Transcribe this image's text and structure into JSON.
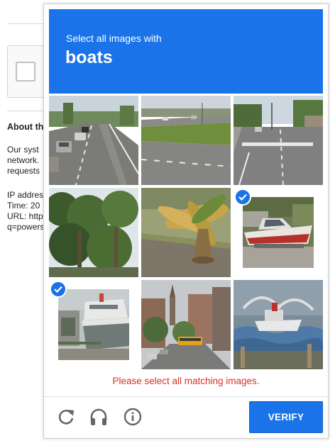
{
  "background_page": {
    "heading": "About th",
    "para1": [
      "Our syst",
      "network.",
      "requests"
    ],
    "para2": [
      "IP addres",
      "Time: 20",
      "URL: http",
      "q=powers"
    ]
  },
  "challenge": {
    "instruction": "Select all images with",
    "keyword": "boats",
    "tiles": [
      {
        "selected": false
      },
      {
        "selected": false
      },
      {
        "selected": false
      },
      {
        "selected": false
      },
      {
        "selected": false
      },
      {
        "selected": true
      },
      {
        "selected": true
      },
      {
        "selected": false
      },
      {
        "selected": false
      }
    ],
    "error_message": "Please select all matching images.",
    "verify_label": "VERIFY"
  },
  "icons": {
    "reload": "reload-icon",
    "audio": "headphones-icon",
    "info": "info-icon"
  },
  "colors": {
    "accent": "#1a73e8",
    "error": "#d93025"
  }
}
